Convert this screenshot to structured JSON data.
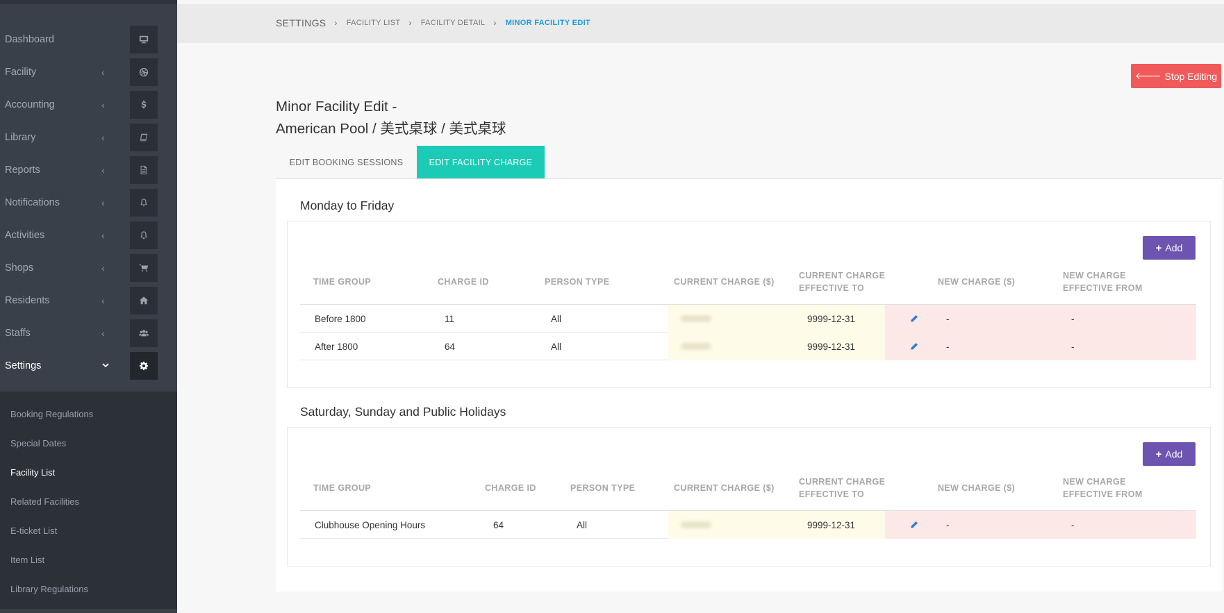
{
  "sidebar": {
    "items": [
      {
        "label": "Dashboard",
        "icon": "monitor-icon",
        "chevron": ""
      },
      {
        "label": "Facility",
        "icon": "dribbble-icon",
        "chevron": "‹"
      },
      {
        "label": "Accounting",
        "icon": "dollar-icon",
        "chevron": "‹"
      },
      {
        "label": "Library",
        "icon": "book-icon",
        "chevron": "‹"
      },
      {
        "label": "Reports",
        "icon": "file-icon",
        "chevron": "‹"
      },
      {
        "label": "Notifications",
        "icon": "bell-icon",
        "chevron": "‹"
      },
      {
        "label": "Activities",
        "icon": "bell-icon",
        "chevron": "‹"
      },
      {
        "label": "Shops",
        "icon": "cart-icon",
        "chevron": "‹"
      },
      {
        "label": "Residents",
        "icon": "home-icon",
        "chevron": "‹"
      },
      {
        "label": "Staffs",
        "icon": "users-icon",
        "chevron": "‹"
      },
      {
        "label": "Settings",
        "icon": "gear-icon",
        "chevron": "⌄"
      }
    ],
    "submenu": [
      "Booking Regulations",
      "Special Dates",
      "Facility List",
      "Related Facilities",
      "E-ticket List",
      "Item List",
      "Library Regulations"
    ],
    "active_submenu": "Facility List"
  },
  "breadcrumb": {
    "root": "SETTINGS",
    "items": [
      "FACILITY LIST",
      "FACILITY DETAIL"
    ],
    "current": "MINOR FACILITY EDIT"
  },
  "stop_button": "Stop Editing",
  "title_line1": "Minor Facility Edit -",
  "title_line2": "American Pool / 美式桌球 / 美式桌球",
  "tabs": [
    "EDIT BOOKING SESSIONS",
    "EDIT FACILITY CHARGE"
  ],
  "active_tab": "EDIT FACILITY CHARGE",
  "add_label": "Add",
  "columns": {
    "time_group": "TIME GROUP",
    "charge_id": "CHARGE ID",
    "person_type": "PERSON TYPE",
    "current_charge": "CURRENT CHARGE ($)",
    "effective_to_1": "CURRENT CHARGE",
    "effective_to_2": "EFFECTIVE TO",
    "new_charge": "NEW CHARGE ($)",
    "effective_from_1": "NEW CHARGE",
    "effective_from_2": "EFFECTIVE FROM"
  },
  "sections": [
    {
      "title": "Monday to Friday",
      "rows": [
        {
          "time_group": "Before 1800",
          "charge_id": "11",
          "person_type": "All",
          "effective_to": "9999-12-31",
          "new_charge": "-",
          "effective_from": "-"
        },
        {
          "time_group": "After 1800",
          "charge_id": "64",
          "person_type": "All",
          "effective_to": "9999-12-31",
          "new_charge": "-",
          "effective_from": "-"
        }
      ]
    },
    {
      "title": "Saturday, Sunday and Public Holidays",
      "rows": [
        {
          "time_group": "Clubhouse Opening Hours",
          "charge_id": "64",
          "person_type": "All",
          "effective_to": "9999-12-31",
          "new_charge": "-",
          "effective_from": "-"
        }
      ]
    }
  ],
  "colors": {
    "accent_tab": "#1ccbb5",
    "stop_button": "#f15a5a",
    "add_button": "#6c54b0",
    "breadcrumb_active": "#1a9bd7"
  }
}
